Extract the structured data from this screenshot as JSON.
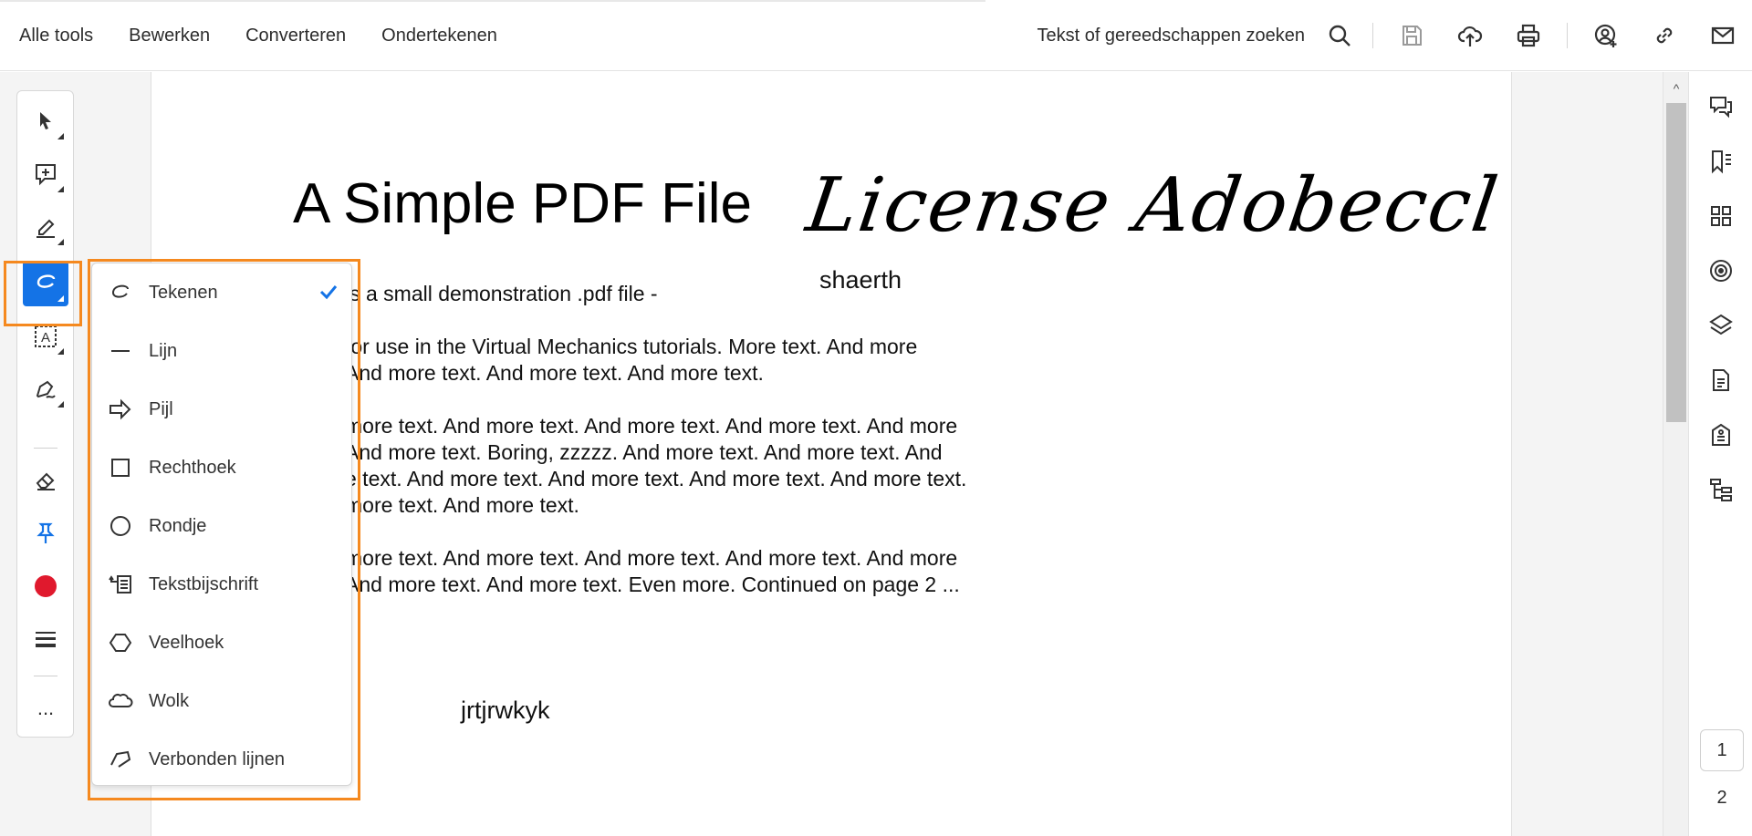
{
  "topnav": {
    "items": [
      "Alle tools",
      "Bewerken",
      "Converteren",
      "Ondertekenen"
    ],
    "search_label": "Tekst of gereedschappen zoeken"
  },
  "icons": {
    "top": [
      "search-icon",
      "save-icon",
      "cloud-upload-icon",
      "print-icon",
      "add-user-icon",
      "link-icon",
      "mail-icon"
    ],
    "left_tools": [
      "select-icon",
      "comment-icon",
      "highlight-icon",
      "draw-icon",
      "text-box-icon",
      "signature-icon",
      "eraser-icon",
      "pin-icon",
      "color-icon",
      "line-weight-icon",
      "more-icon"
    ],
    "right": [
      "comments-icon",
      "bookmarks-icon",
      "thumbnails-icon",
      "target-icon",
      "layers-icon",
      "document-icon",
      "accessibility-icon",
      "structure-icon"
    ]
  },
  "left_more": "...",
  "colors": {
    "accent": "#1473e6",
    "highlight_outline": "#f5891f",
    "color_swatch": "#e0192d"
  },
  "pdf": {
    "title": "A Simple PDF File",
    "signature": "License Adobeccl",
    "annotation1": "shaerth",
    "annotation2": "jrtjrwkyk",
    "lines": [
      "is a small demonstration .pdf file -",
      "for use in the Virtual Mechanics tutorials. More text. And more",
      "And more text. And more text. And more text.",
      "more text. And more text. And more text. And more text. And more",
      "And more text. Boring, zzzzz. And more text. And more text. And",
      "e text. And more text. And more text. And more text. And more text.",
      "more text. And more text.",
      "more text. And more text. And more text. And more text. And more",
      "And more text. And more text. Even more. Continued on page 2 ..."
    ]
  },
  "dropdown": {
    "items": [
      {
        "label": "Tekenen",
        "icon": "freehand-icon",
        "checked": true
      },
      {
        "label": "Lijn",
        "icon": "line-icon",
        "checked": false
      },
      {
        "label": "Pijl",
        "icon": "arrow-icon",
        "checked": false
      },
      {
        "label": "Rechthoek",
        "icon": "rectangle-icon",
        "checked": false
      },
      {
        "label": "Rondje",
        "icon": "circle-icon",
        "checked": false
      },
      {
        "label": "Tekstbijschrift",
        "icon": "callout-icon",
        "checked": false
      },
      {
        "label": "Veelhoek",
        "icon": "polygon-icon",
        "checked": false
      },
      {
        "label": "Wolk",
        "icon": "cloud-icon",
        "checked": false
      },
      {
        "label": "Verbonden lijnen",
        "icon": "polyline-icon",
        "checked": false
      }
    ]
  },
  "pages": {
    "current": "1",
    "next": "2"
  }
}
